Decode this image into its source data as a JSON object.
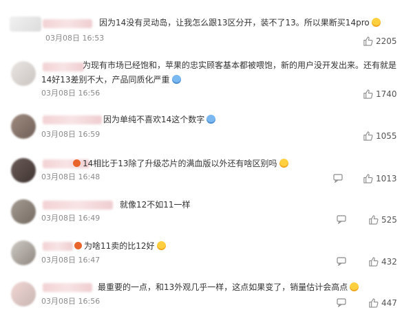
{
  "comments": [
    {
      "text": "因为14没有灵动岛，让我怎么跟13区分开，装不了13。所以果断买14pro",
      "time": "03月08日 16:53",
      "likes": "2205",
      "emoji": "face-grin-icon",
      "has_reply": false
    },
    {
      "text": "为现有市场已经饱和，苹果的忠实顾客基本都被喂饱，新的用户没开发出来。还有就是14好13差别不大，产品同质化严重",
      "time": "03月08日 16:56",
      "likes": "1740",
      "emoji": "face-laugh-icon",
      "has_reply": false
    },
    {
      "text": "因为单纯不喜欢14这个数字",
      "time": "03月08日 16:59",
      "likes": "1055",
      "emoji": "face-cover-icon",
      "has_reply": false
    },
    {
      "text": "14相比于13除了升级芯片的满血版以外还有啥区别吗",
      "time": "03月08日 16:48",
      "likes": "1013",
      "emoji": "face-smirk-icon",
      "has_reply": false
    },
    {
      "text": "就像12不如11一样",
      "time": "03月08日 16:49",
      "likes": "525",
      "has_reply": true
    },
    {
      "text": "为啥11卖的比12好",
      "time": "03月08日 16:47",
      "likes": "432",
      "emoji": "face-tears-joy-icon",
      "has_reply": true
    },
    {
      "text": "最重要的一点，和13外观几乎一样，这点如果变了，销量估计会高点",
      "time": "03月08日 16:56",
      "likes": "447",
      "emoji": "face-grin-icon",
      "has_reply": true
    }
  ]
}
